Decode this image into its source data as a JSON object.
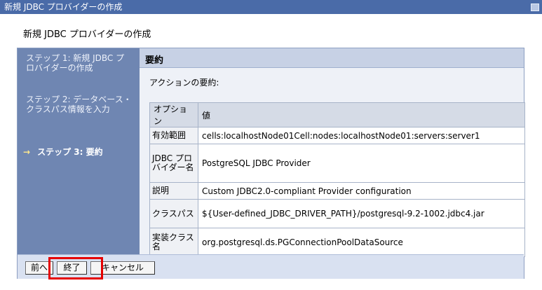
{
  "window": {
    "title": "新規 JDBC プロバイダーの作成"
  },
  "page": {
    "subtitle": "新規 JDBC プロバイダーの作成"
  },
  "steps": [
    {
      "label": "ステップ 1: 新規 JDBC プロバイダーの作成",
      "current": false
    },
    {
      "label": "ステップ 2: データベース・クラスパス情報を入力",
      "current": false
    },
    {
      "label": "ステップ 3: 要約",
      "current": true
    }
  ],
  "current_step_arrow": "→",
  "main": {
    "heading": "要約",
    "actions_caption": "アクションの要約:",
    "table": {
      "headers": [
        "オプション",
        "値"
      ],
      "rows": [
        {
          "option": "有効範囲",
          "value": "cells:localhostNode01Cell:nodes:localhostNode01:servers:server1"
        },
        {
          "option": "JDBC プロバイダー名",
          "value": "PostgreSQL JDBC Provider"
        },
        {
          "option": "説明",
          "value": "Custom JDBC2.0-compliant Provider configuration"
        },
        {
          "option": "クラスパス",
          "value": "${User-defined_JDBC_DRIVER_PATH}/postgresql-9.2-1002.jdbc4.jar"
        },
        {
          "option": "実装クラス名",
          "value": "org.postgresql.ds.PGConnectionPoolDataSource"
        }
      ]
    }
  },
  "buttons": {
    "previous": "前へ",
    "finish": "終了",
    "cancel": "キャンセル"
  },
  "colors": {
    "title_bar": "#4a6ba8",
    "nav": "#6f86b2",
    "highlight": "#e60000"
  }
}
